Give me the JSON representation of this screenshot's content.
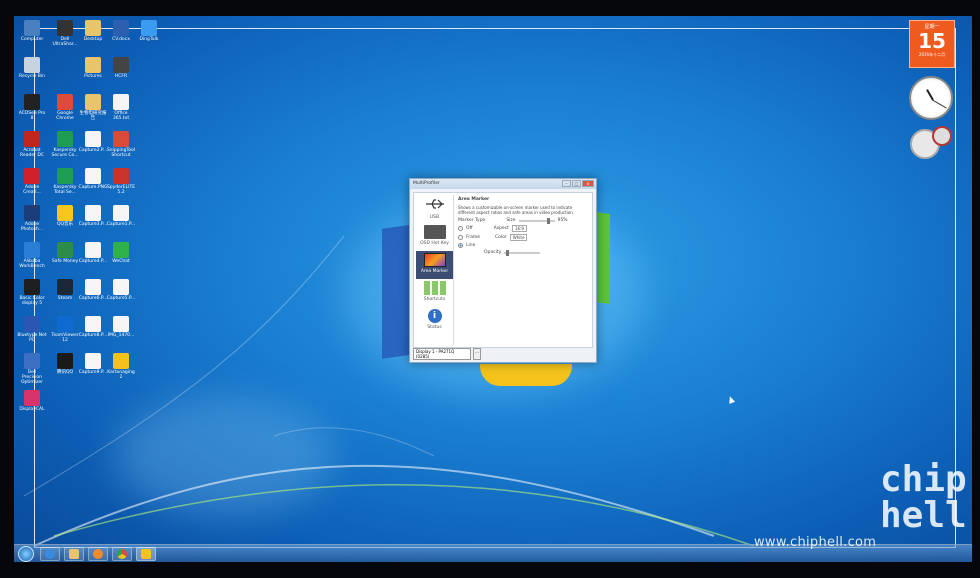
{
  "desktop": {
    "icons": [
      {
        "label": "Computer",
        "color": "#4a7fc0"
      },
      {
        "label": "Dell UltraShar...",
        "color": "#333"
      },
      {
        "label": "Desktop",
        "color": "#e8c56a"
      },
      {
        "label": "CV.docx",
        "color": "#2b5fb0"
      },
      {
        "label": "DingTalk",
        "color": "#3a9bf0"
      },
      {
        "label": "Recycle Bin",
        "color": "#c6d4e2"
      },
      {
        "label": "",
        "color": ""
      },
      {
        "label": "Pictures",
        "color": "#e8c56a"
      },
      {
        "label": "HCFR",
        "color": "#444"
      },
      {
        "label": "",
        "color": ""
      },
      {
        "label": "ACDSee Pro 8",
        "color": "#222"
      },
      {
        "label": "Google Chrome",
        "color": "#e04a3a"
      },
      {
        "label": "生物电研究报告",
        "color": "#e8c56a"
      },
      {
        "label": "Office 365.txt",
        "color": "#f5f5f5"
      },
      {
        "label": "",
        "color": ""
      },
      {
        "label": "Acrobat Reader DC",
        "color": "#c0251e"
      },
      {
        "label": "Kaspersky Secure Co...",
        "color": "#1e9b55"
      },
      {
        "label": "Capture2.P...",
        "color": "#f5f5f5"
      },
      {
        "label": "SnippingTool Shortcut",
        "color": "#d94a3b"
      },
      {
        "label": "",
        "color": ""
      },
      {
        "label": "Adobe Creati...",
        "color": "#d0202a"
      },
      {
        "label": "Kaspersky Total Se...",
        "color": "#1e9b55"
      },
      {
        "label": "Capture.PNG",
        "color": "#f5f5f5"
      },
      {
        "label": "SpyderELITE 5.2",
        "color": "#c8332a"
      },
      {
        "label": "",
        "color": ""
      },
      {
        "label": "Adobe Photosh...",
        "color": "#1b3e7a"
      },
      {
        "label": "QQ音乐",
        "color": "#f6c81c"
      },
      {
        "label": "Capture3.P...",
        "color": "#f5f5f5"
      },
      {
        "label": "Capture1.P...",
        "color": "#f5f5f5"
      },
      {
        "label": "",
        "color": ""
      },
      {
        "label": "Alibaba WorkBench",
        "color": "#2a7fd4"
      },
      {
        "label": "Safe Money",
        "color": "#2c8c4a"
      },
      {
        "label": "Capture4.P...",
        "color": "#f5f5f5"
      },
      {
        "label": "WeChat",
        "color": "#2fb24c"
      },
      {
        "label": "",
        "color": ""
      },
      {
        "label": "Basic Color display 5",
        "color": "#1f1f1f"
      },
      {
        "label": "Steam",
        "color": "#1b2838"
      },
      {
        "label": "Capture6.P...",
        "color": "#f5f5f5"
      },
      {
        "label": "Capture5.P...",
        "color": "#f5f5f5"
      },
      {
        "label": "",
        "color": ""
      },
      {
        "label": "Bluetype Net PC",
        "color": "#2a57b3"
      },
      {
        "label": "TeamViewer 12",
        "color": "#0e6ad0"
      },
      {
        "label": "Capture8.P...",
        "color": "#f5f5f5"
      },
      {
        "label": "IMG_1470...",
        "color": "#f5f5f5"
      },
      {
        "label": "",
        "color": ""
      },
      {
        "label": "Dell Precision Optimizer",
        "color": "#3b6fc4"
      },
      {
        "label": "腾讯QQ",
        "color": "#1a1a1a"
      },
      {
        "label": "Capture9.P...",
        "color": "#f5f5f5"
      },
      {
        "label": "Kartonaging 2",
        "color": "#f1c21b"
      },
      {
        "label": "",
        "color": ""
      },
      {
        "label": "DisplayCAL",
        "color": "#d8336a"
      }
    ]
  },
  "gadgets": {
    "calendar_month": "星期一",
    "calendar_day": "15",
    "calendar_sub": "2016年十二月"
  },
  "window": {
    "title": "MultiProfiler",
    "minimize": "–",
    "maximize": "□",
    "close": "x",
    "sidebar": [
      {
        "label": "USB",
        "selected": false
      },
      {
        "label": "OSD Hot Key",
        "selected": false
      },
      {
        "label": "Area Marker",
        "selected": true
      },
      {
        "label": "Shortcuts",
        "selected": false
      },
      {
        "label": "Status",
        "selected": false
      }
    ],
    "panel": {
      "heading": "Area Marker",
      "description": "Shows a customizable on-screen marker used to indicate different aspect ratios and safe areas in video production.",
      "marker_type_label": "Marker Type",
      "size_label": "Size",
      "size_value": "95%",
      "options": [
        {
          "label": "Off",
          "checked": false
        },
        {
          "label": "Frame",
          "checked": false
        },
        {
          "label": "Line",
          "checked": true
        }
      ],
      "aspect_label": "Aspect",
      "aspect_value": "16:9",
      "color_label": "Color",
      "color_value": "White",
      "opacity_label": "Opacity"
    },
    "footer_display": "Display 1 - PA271Q (0285)",
    "footer_button": "..."
  },
  "watermark": "www.chiphell.com",
  "logo": "chip hell"
}
